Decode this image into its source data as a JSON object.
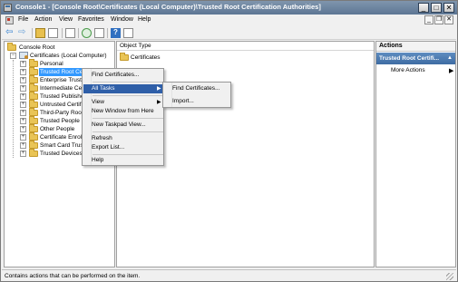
{
  "window": {
    "title": "Console1 - [Console Root\\Certificates (Local Computer)\\Trusted Root Certification Authorities]",
    "min_glyph": "_",
    "max_glyph": "□",
    "close_glyph": "✕"
  },
  "menubar": {
    "items": [
      "File",
      "Action",
      "View",
      "Favorites",
      "Window",
      "Help"
    ],
    "min_glyph": "_",
    "restore_glyph": "❐",
    "close_glyph": "✕"
  },
  "toolbar": {
    "back_glyph": "⇦",
    "forward_glyph": "⇨",
    "help_glyph": "?"
  },
  "tree": {
    "root": "Console Root",
    "certificates": "Certificates (Local Computer)",
    "items": [
      "Personal",
      "Trusted Root Certi",
      "Enterprise Trust",
      "Intermediate Certi",
      "Trusted Publishers",
      "Untrusted Certific",
      "Third-Party Root",
      "Trusted People",
      "Other People",
      "Certificate Enrollm",
      "Smart Card Truste",
      "Trusted Devices"
    ],
    "selected_index": 1
  },
  "content": {
    "column_header": "Object Type",
    "rows": [
      "Certificates"
    ]
  },
  "actions": {
    "header": "Actions",
    "group_title": "Trusted Root Certifi...",
    "group_arrow": "▲",
    "more_actions": "More Actions",
    "more_arrow": "▶"
  },
  "context_menu": {
    "items": [
      {
        "label": "Find Certificates...",
        "has_submenu": false
      },
      {
        "label": "All Tasks",
        "has_submenu": true,
        "highlighted": true
      },
      {
        "label": "View",
        "has_submenu": true
      },
      {
        "label": "New Window from Here",
        "has_submenu": false
      },
      {
        "label": "New Taskpad View...",
        "has_submenu": false
      },
      {
        "label": "Refresh",
        "has_submenu": false
      },
      {
        "label": "Export List...",
        "has_submenu": false
      },
      {
        "label": "Help",
        "has_submenu": false
      }
    ],
    "submenu_arrow": "▶"
  },
  "submenu": {
    "items": [
      "Find Certificates...",
      "Import..."
    ]
  },
  "statusbar": {
    "text": "Contains actions that can be performed on the item."
  },
  "colors": {
    "title_bar": "#5d7694",
    "selection": "#3399ff",
    "menu_highlight": "#2f5fa8",
    "actions_group": "#3e6ca3"
  },
  "icons": [
    "app-icon",
    "back-arrow-icon",
    "forward-arrow-icon",
    "folder-icon",
    "certificate-icon",
    "refresh-icon",
    "help-icon"
  ]
}
